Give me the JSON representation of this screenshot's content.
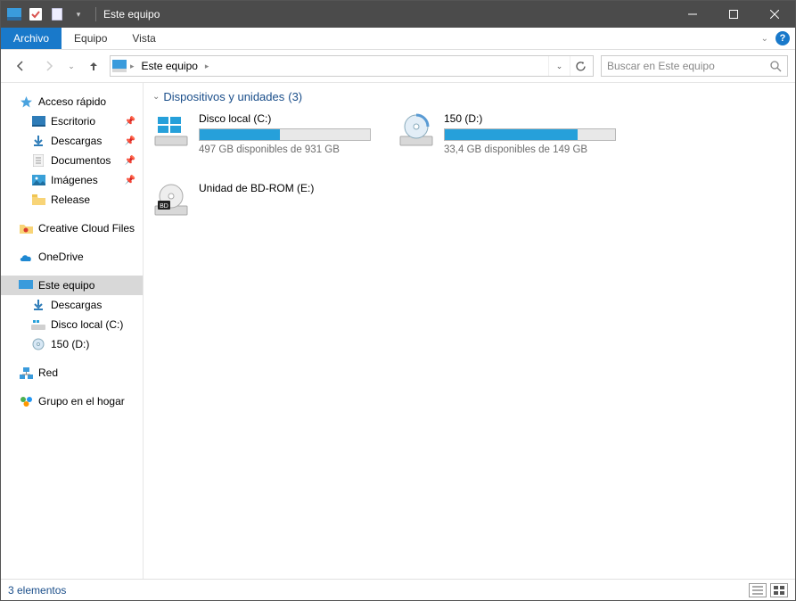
{
  "window": {
    "title": "Este equipo"
  },
  "menu": {
    "file": "Archivo",
    "computer": "Equipo",
    "view": "Vista"
  },
  "nav": {
    "location_label": "Este equipo",
    "search_placeholder": "Buscar en Este equipo"
  },
  "sidebar": {
    "quick_access": "Acceso rápido",
    "desktop": "Escritorio",
    "downloads": "Descargas",
    "documents": "Documentos",
    "pictures": "Imágenes",
    "release": "Release",
    "creative_cloud": "Creative Cloud Files",
    "onedrive": "OneDrive",
    "this_pc": "Este equipo",
    "this_pc_downloads": "Descargas",
    "local_disk": "Disco local (C:)",
    "disk_d": "150 (D:)",
    "network": "Red",
    "homegroup": "Grupo en el hogar"
  },
  "main": {
    "section_title": "Dispositivos y unidades",
    "section_count": "(3)",
    "drives": [
      {
        "name": "Disco local (C:)",
        "status": "497 GB disponibles de 931 GB",
        "fill_pct": 47,
        "icon": "windows"
      },
      {
        "name": "150 (D:)",
        "status": "33,4 GB disponibles de 149 GB",
        "fill_pct": 78,
        "icon": "disc"
      },
      {
        "name": "Unidad de BD-ROM (E:)",
        "status": "",
        "fill_pct": null,
        "icon": "bd"
      }
    ]
  },
  "statusbar": {
    "count": "3 elementos"
  }
}
